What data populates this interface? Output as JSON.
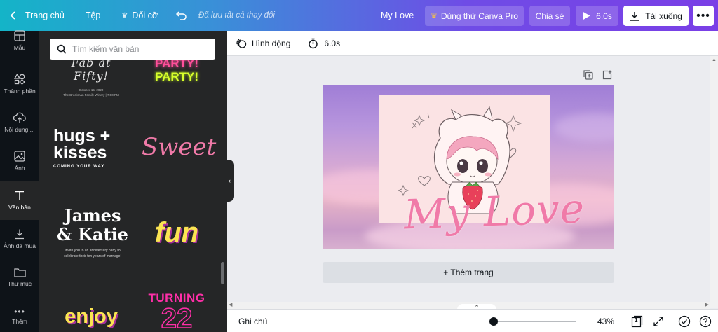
{
  "topbar": {
    "home_label": "Trang chủ",
    "file_label": "Tệp",
    "resize_label": "Đổi cỡ",
    "saved_status": "Đã lưu tất cả thay đổi",
    "title": "My Love",
    "pro_label": "Dùng thử Canva Pro",
    "share_label": "Chia sẻ",
    "play_duration": "6.0s",
    "download_label": "Tải xuống"
  },
  "rail": {
    "items": [
      {
        "label": "Mẫu",
        "icon": "templates-icon"
      },
      {
        "label": "Thành phần",
        "icon": "elements-icon"
      },
      {
        "label": "Nội dung ...",
        "icon": "upload-icon"
      },
      {
        "label": "Ảnh",
        "icon": "photo-icon"
      },
      {
        "label": "Văn bản",
        "icon": "text-icon"
      },
      {
        "label": "Ảnh đã mua",
        "icon": "download-icon"
      },
      {
        "label": "Thư mục",
        "icon": "folder-icon"
      },
      {
        "label": "Thêm",
        "icon": "more-icon"
      }
    ]
  },
  "panel": {
    "search_placeholder": "Tìm kiếm văn bản",
    "templates": {
      "fab_title": "Fab at Fifty!",
      "fab_line1": "October 15, 2020",
      "fab_line2": "The Brockman Family Winery | 7:00 PM",
      "party": "PARTY!",
      "party2": "PARTY!",
      "hugs_line1": "hugs +",
      "hugs_line2": "kisses",
      "hugs_sub": "COMING YOUR WAY",
      "sweet": "Sweet",
      "james_line1": "James",
      "james_line2": "& Katie",
      "james_sub1": "Invite you to an anniversary party to",
      "james_sub2": "celebrate their ten years of marriage!",
      "fun": "fun",
      "enjoy": "enjoy",
      "turning": "TURNING",
      "turning_num": "22"
    }
  },
  "subbar": {
    "animate_label": "Hình động",
    "duration": "6.0s"
  },
  "design": {
    "script_text": "My Love"
  },
  "canvas": {
    "add_page_label": "+ Thêm trang"
  },
  "bottombar": {
    "notes_label": "Ghi chú",
    "zoom": "43%",
    "zoom_fraction": 0.43,
    "page_count": "1"
  },
  "colors": {
    "accent": "#7d2ae8",
    "rail_bg": "#0e1318",
    "panel_bg": "#252627",
    "script_pink": "#f07aa8"
  }
}
